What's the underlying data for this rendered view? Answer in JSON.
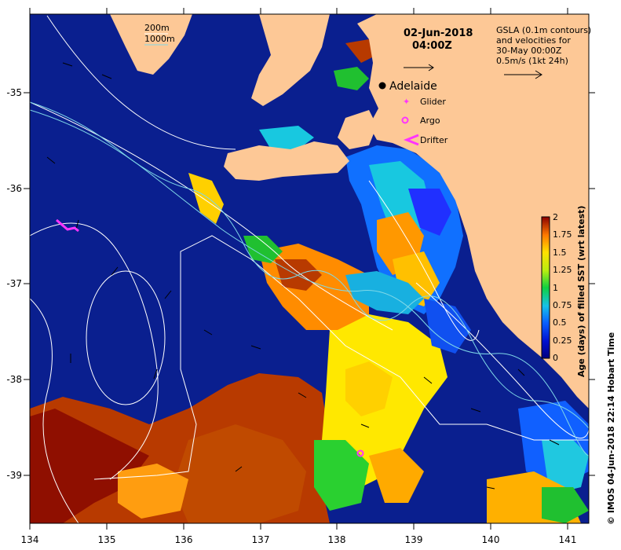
{
  "title": {
    "date": "02-Jun-2018",
    "time": "04:00Z"
  },
  "contour_legend": {
    "line1": "200m",
    "line2": "1000m",
    "color1": "#ffffff",
    "color2": "#7fd8e8"
  },
  "gsla_note": {
    "line1": "GSLA (0.1m contours)",
    "line2": "and velocities for",
    "line3": "30-May 00:00Z",
    "line4": "0.5m/s (1kt 24h)"
  },
  "legend": {
    "adelaide": "Adelaide",
    "glider": "Glider",
    "argo": "Argo",
    "drifter": "Drifter",
    "marker_color": "#ff33ff"
  },
  "colorbar": {
    "label": "Age (days) of filled SST (wrt latest)",
    "ticks": [
      "0",
      "0.25",
      "0.5",
      "0.75",
      "1",
      "1.25",
      "1.5",
      "1.75",
      "2"
    ]
  },
  "credit": "© IMOS 04-Jun-2018 22:14 Hobart Time",
  "axes": {
    "x_ticks": [
      "134",
      "135",
      "136",
      "137",
      "138",
      "139",
      "140",
      "141"
    ],
    "y_ticks": [
      "-35",
      "-36",
      "-37",
      "-38",
      "-39"
    ],
    "xlim": [
      134,
      141.3
    ],
    "ylim": [
      -39.5,
      -34.2
    ]
  },
  "colors": {
    "land": "#fdc896",
    "ocean_old": "#0a1f8f",
    "ocean_deep": "#061a7a"
  }
}
